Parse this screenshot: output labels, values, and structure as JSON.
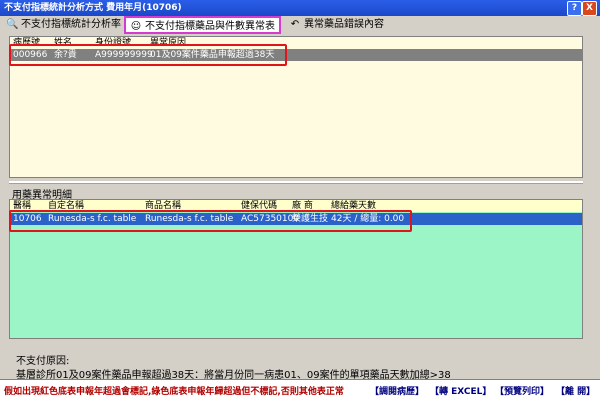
{
  "window": {
    "title": "不支付指標統計分析方式  費用年月(10706)",
    "help": "?",
    "close": "X"
  },
  "tabs": [
    {
      "label": "不支付指標統計分析率",
      "icon": "search-icon"
    },
    {
      "label": "不支付指標藥品與件數異常表",
      "icon": "doctor-icon"
    },
    {
      "label": "異常藥品錯誤內容",
      "icon": "back-arrow-icon"
    }
  ],
  "top_table": {
    "headers": [
      "病歷號",
      "姓名",
      "身份證號",
      "異常原因"
    ],
    "rows": [
      {
        "id": "000966",
        "name": "余?貴",
        "idno": "A999999999",
        "reason": "01及09案件藥品申報超過38天"
      }
    ]
  },
  "bottom_section": {
    "label": "用藥異常明細",
    "headers": [
      "醫稱",
      "自定名稱",
      "商品名稱",
      "健保代碼",
      "廠 商",
      "總給藥天數"
    ],
    "rows": [
      {
        "code": "10706",
        "custom": "Runesda-s f.c. table",
        "product": "Runesda-s f.c. table",
        "nhi": "AC57350100",
        "vendor": "榮護生技",
        "total": "42天 / 總量: 0.00"
      }
    ]
  },
  "reason": {
    "title": "不支付原因:",
    "text": "基層診所01及09案件藥品申報超過38天：將當月份同一病患01、09案件的單項藥品天數加總>38"
  },
  "status": {
    "warning": "假如出現紅色底表申報年超過會標記,綠色底表申報年歸超過但不標記,否則其他表正常",
    "buttons": [
      "【調閱病歷】",
      "【轉 EXCEL】",
      "【預覽列印】",
      "【離 開】"
    ]
  },
  "colors": {
    "title_bar": "#1a48c9",
    "top_panel_bg": "#fffbe0",
    "bottom_panel_bg": "#9cf5c6",
    "highlight_box": "#e0141a",
    "active_tab_border": "#d63bd0"
  }
}
